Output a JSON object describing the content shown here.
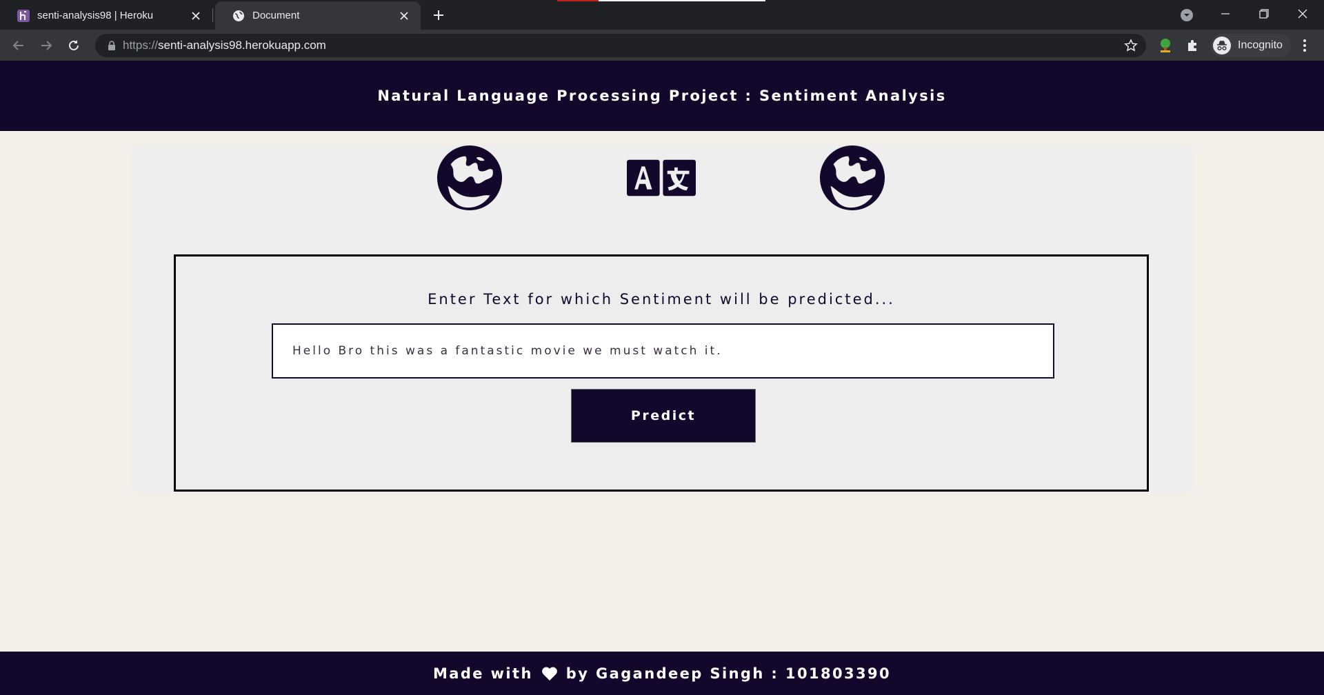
{
  "browser": {
    "tabs": [
      {
        "title": "senti-analysis98 | Heroku",
        "favicon": "heroku-icon",
        "active": false
      },
      {
        "title": "Document",
        "favicon": "globe-icon",
        "active": true
      }
    ],
    "url": {
      "scheme": "https://",
      "host": "senti-analysis98.herokuapp.com"
    },
    "profile_label": "Incognito",
    "accent": "#202124"
  },
  "page": {
    "header_title": "Natural Language Processing Project : Sentiment Analysis",
    "icons": [
      "globe-icon",
      "translate-icon",
      "globe-icon"
    ],
    "prompt": "Enter Text for which Sentiment will be predicted...",
    "input_value": "Hello Bro this was a fantastic movie we must watch it.",
    "predict_label": "Predict",
    "footer_prefix": "Made with",
    "footer_suffix": "by Gagandeep Singh : 101803390",
    "colors": {
      "primary": "#13082b",
      "background": "#f3eee7",
      "card": "#efeeee"
    }
  }
}
